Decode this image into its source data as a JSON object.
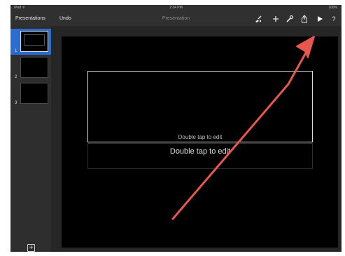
{
  "status_bar": {
    "carrier": "iPad ᯤ",
    "time": "2:34 PM",
    "battery": "100%"
  },
  "toolbar": {
    "presentations_label": "Presentations",
    "undo_label": "Undo",
    "document_title": "Presentation",
    "icons": [
      "brush-icon",
      "plus-icon",
      "wrench-icon",
      "share-icon",
      "play-icon",
      "help-icon"
    ],
    "help_glyph": "?"
  },
  "sidebar": {
    "slides": [
      {
        "number": "1",
        "selected": true
      },
      {
        "number": "2",
        "selected": false
      },
      {
        "number": "3",
        "selected": false
      }
    ],
    "add_slide_glyph": "+"
  },
  "slide": {
    "title_placeholder": "Double tap to edit",
    "subtitle_placeholder": "Double tap to edit"
  },
  "colors": {
    "toolbar_bg": "#303030",
    "selection_blue": "#2a6ccf",
    "annotation_red": "#e8574d"
  }
}
